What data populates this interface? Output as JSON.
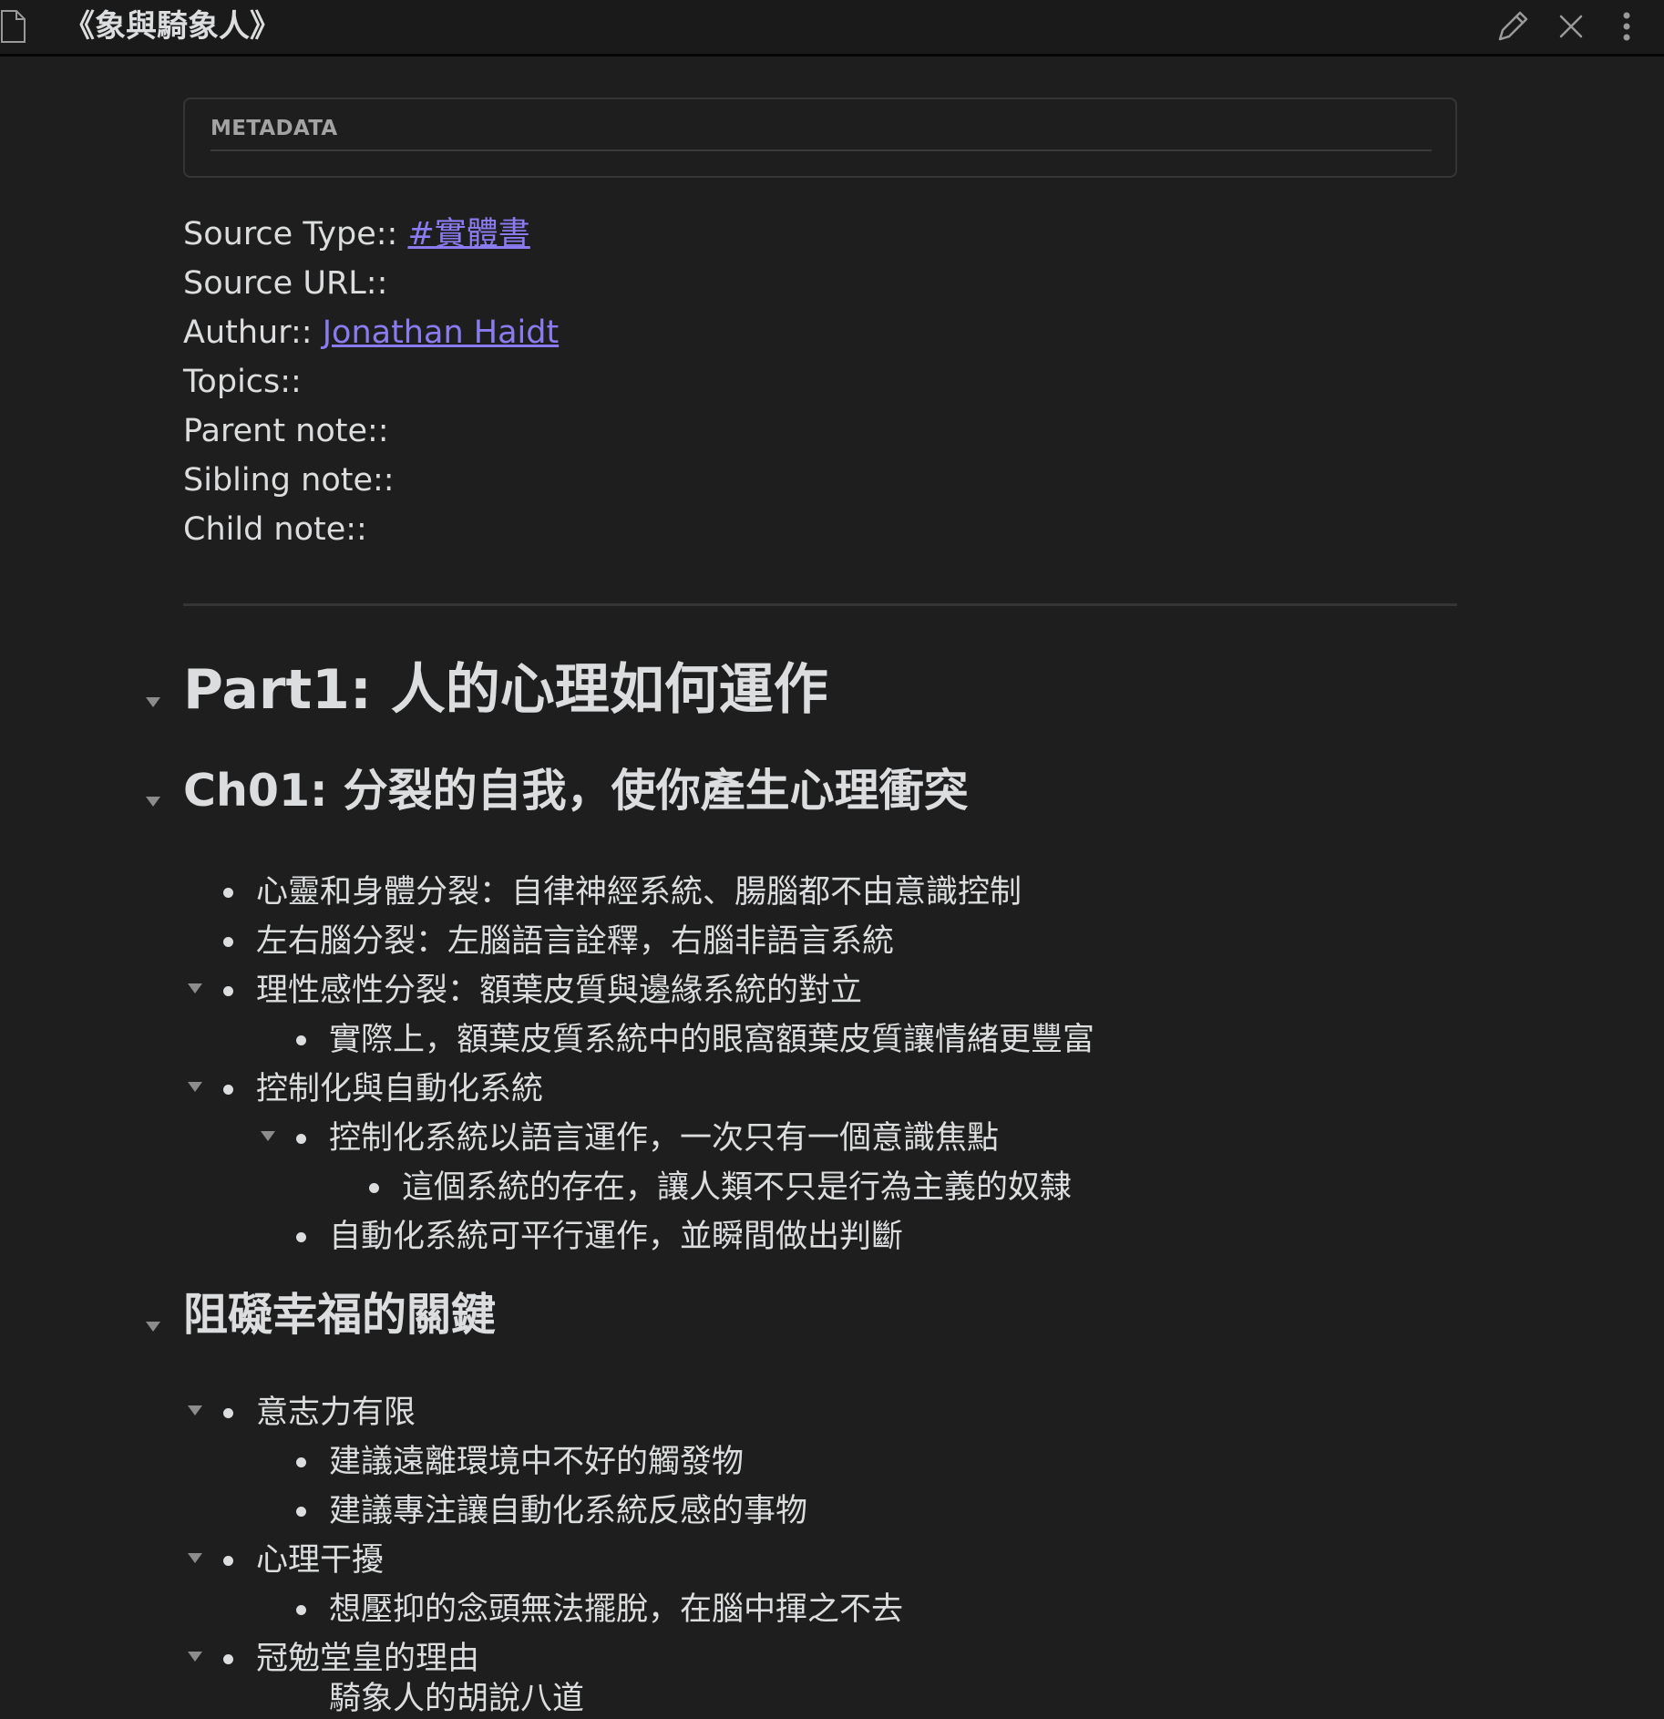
{
  "title_bar": {
    "title": "《象與騎象人》",
    "icons": [
      "file-icon",
      "pencil-icon",
      "close-icon",
      "more-vertical-icon"
    ]
  },
  "metadata": {
    "label": "METADATA"
  },
  "properties": {
    "source_type_label": "Source Type::",
    "source_type_value": "#實體書",
    "source_url_label": "Source URL::",
    "author_label": "Authur::",
    "author_value": "Jonathan Haidt",
    "topics_label": "Topics::",
    "parent_note_label": "Parent note::",
    "sibling_note_label": "Sibling note::",
    "child_note_label": "Child note::"
  },
  "colors": {
    "background": "#1e1e1e",
    "text": "#dcddde",
    "link": "#8a7cf0"
  },
  "document": {
    "part1_heading": "Part1: 人的心理如何運作",
    "ch01_heading": "Ch01: 分裂的自我，使你產生心理衝突",
    "ch01_items": [
      "心靈和身體分裂：自律神經系統、腸腦都不由意識控制",
      "左右腦分裂：左腦語言詮釋，右腦非語言系統",
      "理性感性分裂：額葉皮質與邊緣系統的對立",
      "實際上，額葉皮質系統中的眼窩額葉皮質讓情緒更豐富",
      "控制化與自動化系統",
      "控制化系統以語言運作，一次只有一個意識焦點",
      "這個系統的存在，讓人類不只是行為主義的奴隸",
      "自動化系統可平行運作，並瞬間做出判斷"
    ],
    "happiness_heading": "阻礙幸福的關鍵",
    "happiness_items": [
      "意志力有限",
      "建議遠離環境中不好的觸發物",
      "建議專注讓自動化系統反感的事物",
      "心理干擾",
      "想壓抑的念頭無法擺脫，在腦中揮之不去",
      "冠勉堂皇的理由",
      "騎象人的胡說八道"
    ]
  }
}
